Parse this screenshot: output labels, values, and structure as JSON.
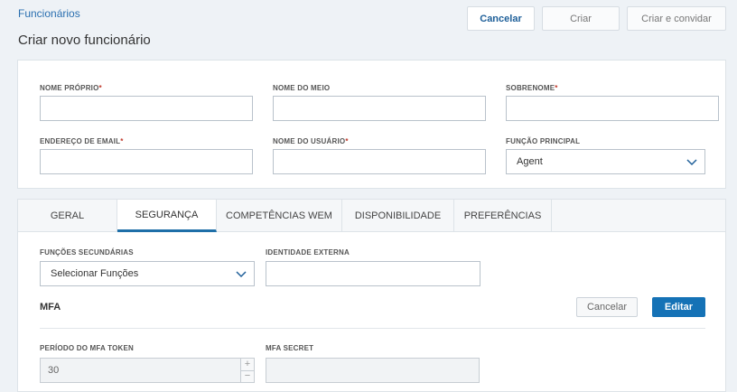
{
  "header": {
    "breadcrumb": "Funcionários",
    "title": "Criar novo funcionário",
    "buttons": {
      "cancel": "Cancelar",
      "create": "Criar",
      "create_invite": "Criar e convidar"
    }
  },
  "form": {
    "first_name": {
      "label": "NOME PRÓPRIO",
      "required": "*",
      "value": ""
    },
    "middle_name": {
      "label": "NOME DO MEIO",
      "value": ""
    },
    "last_name": {
      "label": "SOBRENOME",
      "required": "*",
      "value": ""
    },
    "email": {
      "label": "ENDEREÇO DE EMAIL",
      "required": "*",
      "value": ""
    },
    "username": {
      "label": "NOME DO USUÁRIO",
      "required": "*",
      "value": ""
    },
    "primary_role": {
      "label": "FUNÇÃO PRINCIPAL",
      "value": "Agent"
    }
  },
  "tabs": [
    {
      "label": "GERAL",
      "active": false
    },
    {
      "label": "SEGURANÇA",
      "active": true
    },
    {
      "label": "COMPETÊNCIAS WEM",
      "active": false
    },
    {
      "label": "DISPONIBILIDADE",
      "active": false
    },
    {
      "label": "PREFERÊNCIAS",
      "active": false
    }
  ],
  "security": {
    "secondary_roles": {
      "label": "FUNÇÕES SECUNDÁRIAS",
      "placeholder": "Selecionar Funções"
    },
    "external_identity": {
      "label": "IDENTIDADE EXTERNA",
      "value": ""
    },
    "mfa": {
      "heading": "MFA",
      "cancel_label": "Cancelar",
      "edit_label": "Editar",
      "token_period": {
        "label": "PERÍODO DO MFA TOKEN",
        "value": "30"
      },
      "secret": {
        "label": "MFA SECRET",
        "value": ""
      }
    }
  },
  "colors": {
    "accent": "#1572b6",
    "link": "#2a6fb0",
    "required": "#c0392b",
    "page_bg": "#eef2f6"
  },
  "icons": {
    "dropdown": "chevron-down-icon",
    "increment": "plus-icon",
    "decrement": "minus-icon"
  }
}
